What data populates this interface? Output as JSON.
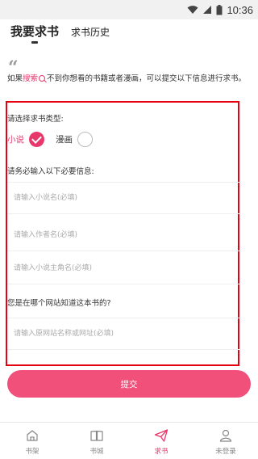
{
  "status_bar": {
    "time": "10:36"
  },
  "tabs": [
    {
      "label": "我要求书",
      "active": true
    },
    {
      "label": "求书历史",
      "active": false
    }
  ],
  "intro": {
    "prefix": "如果",
    "search_link": "搜索",
    "suffix": "不到你想看的书籍或者漫画，可以提交以下信息进行求书。"
  },
  "type_section": {
    "label": "请选择求书类型:",
    "options": [
      {
        "label": "小说",
        "selected": true
      },
      {
        "label": "漫画",
        "selected": false
      }
    ]
  },
  "required_section": {
    "label": "请务必输入以下必要信息:",
    "fields": [
      {
        "placeholder": "请输入小说名(必填)",
        "value": ""
      },
      {
        "placeholder": "请输入作者名(必填)",
        "value": ""
      },
      {
        "placeholder": "请输入小说主角名(必填)",
        "value": ""
      }
    ]
  },
  "source_section": {
    "label": "您是在哪个网站知道这本书的?",
    "field": {
      "placeholder": "请输入原网站名称或网址(必填)",
      "value": ""
    }
  },
  "submit_label": "提交",
  "bottom_nav": [
    {
      "label": "书架",
      "icon": "home-icon",
      "active": false
    },
    {
      "label": "书城",
      "icon": "book-icon",
      "active": false
    },
    {
      "label": "求书",
      "icon": "paper-plane-icon",
      "active": true
    },
    {
      "label": "未登录",
      "icon": "user-icon",
      "active": false
    }
  ],
  "colors": {
    "accent": "#e8376b",
    "button": "#f0507a",
    "frame": "#e60012"
  }
}
